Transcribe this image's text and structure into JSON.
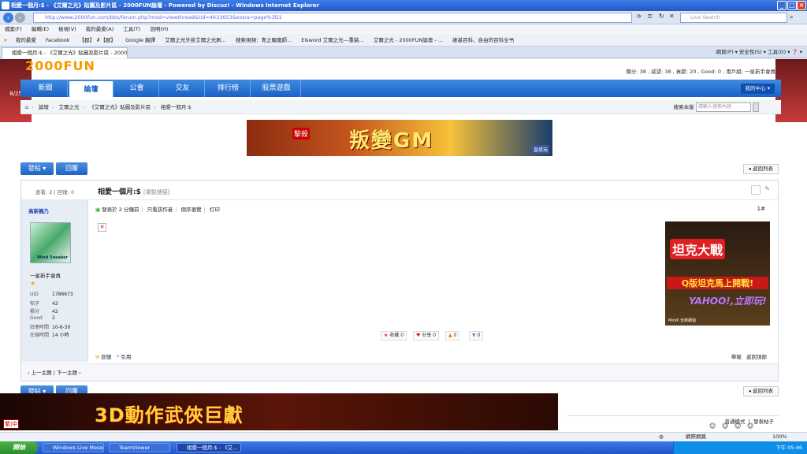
{
  "window": {
    "title": "相愛一個月:$ - 《艾爾之光》貼圖及影片區 - 2000FUN論壇 - Powered by Discuz! - Windows Internet Explorer"
  },
  "address": {
    "url": "http://www.2000fun.com/bbs/forum.php?mod=viewthread&tid=4633653&extra=page%3D1",
    "search_placeholder": "Live Search"
  },
  "menu": [
    "檔案(F)",
    "編輯(E)",
    "檢視(V)",
    "我的最愛(A)",
    "工具(T)",
    "說明(H)"
  ],
  "favorites": [
    "我的最愛",
    "Facebook",
    "【郡】 ✗【郡】",
    "Google 翻譯",
    "艾爾之光外掛艾爾之光刷...",
    "搜索視頻：青之驅魔師...",
    "Elsword 艾爾之光---重裝...",
    "艾爾之光 - 2000FUN論壇 - ...",
    "維基百科，自由的百科全书"
  ],
  "browser_tab": "相愛一個月:$ - 《艾爾之光》貼圖及影片區 - 2000...",
  "toolbar_right": "網頁(P) ▾  安全性(S) ▾  工具(O) ▾  ❓ ▾",
  "site": {
    "logo": "2000FUN",
    "user_stats": "積分: 38 , 威望: 38 , 貢獻: 20 , Good: 0 , 用戶組: 一星新手會員",
    "nav": [
      "新聞",
      "論壇",
      "公會",
      "交友",
      "排行榜",
      "股票遊戲"
    ],
    "my_center": "我的中心 ▾",
    "breadcrumb": [
      "論壇",
      "艾爾之光",
      "《艾爾之光》貼圖及影片區",
      "相愛一個月:$"
    ],
    "search_scope": "搜索本版 ▾",
    "search_placeholder": "請輸入搜索內容"
  },
  "banner": {
    "text": "叛變GM",
    "tag": "擊殺",
    "fb": "直接玩"
  },
  "actions": {
    "post": "發帖 ▾",
    "reply": "回覆",
    "back_list": "◂ 返回列表"
  },
  "thread": {
    "views_label": "查看: 2 | 回復: 0",
    "title": "相愛一個月:$",
    "title_tail": "[複製鏈接]",
    "post_meta": [
      "發表於 2 分鐘前",
      "只看該作者",
      "倒序瀏覽",
      "打印"
    ],
    "floor": "1#",
    "author": {
      "name": "高新楓乃",
      "group": "一星新手會員",
      "avatar_caption": "Wind Sneaker",
      "stats": [
        {
          "k": "UID",
          "v": "1786673"
        },
        {
          "k": "帖子",
          "v": "42"
        },
        {
          "k": "積分",
          "v": "42"
        },
        {
          "k": "Good",
          "v": "2"
        },
        {
          "k": "註冊時間",
          "v": "10-6-30"
        },
        {
          "k": "在線時間",
          "v": "14 小時"
        }
      ]
    },
    "reactions": [
      {
        "label": "收藏",
        "count": "0",
        "icon": "star-icon"
      },
      {
        "label": "分享",
        "count": "0",
        "icon": "heart-icon"
      },
      {
        "label": "",
        "count": "0",
        "icon": "thumbs-up-icon"
      },
      {
        "label": "",
        "count": "0",
        "icon": "thumbs-down-icon"
      }
    ],
    "reply_links": [
      "回復",
      "引用"
    ],
    "report_links": [
      "舉報",
      "返回頂部"
    ],
    "prev_next": "‹ 上一主題 | 下一主題 ›"
  },
  "ad": {
    "title": "坦克大戰",
    "line2": "Q版坦克馬上開戰!",
    "brand": "YAHOO!,立即玩!",
    "footer": "MiniK 全新網遊"
  },
  "bottom_ad": {
    "text": "3D動作武俠巨獻",
    "lang": "繁|中"
  },
  "list_header": {
    "mode": "普通模式",
    "post_new": "發表帖子"
  },
  "statusbar": {
    "zone": "網際網路",
    "zoom": "100%"
  },
  "taskbar": {
    "start": "開始",
    "tasks": [
      "Windows Live Messen...",
      "TeamViewer",
      "相愛一個月:$ - 《艾..."
    ],
    "clock": "下午 05:46"
  }
}
